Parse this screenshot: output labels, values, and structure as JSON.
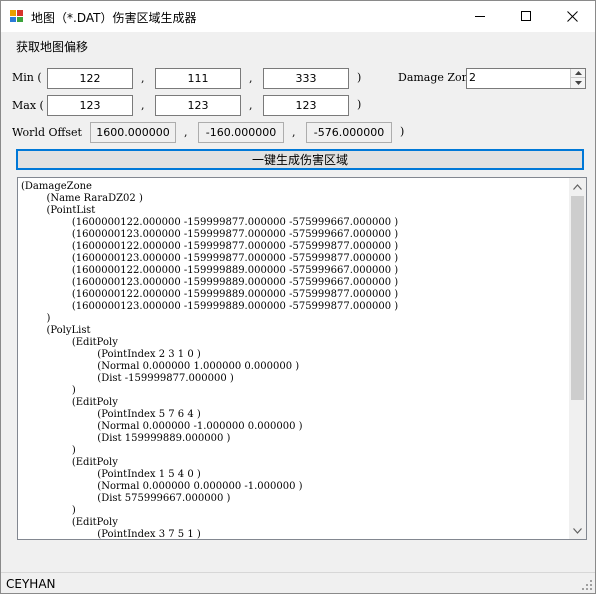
{
  "window": {
    "title": "地图（*.DAT）伤害区域生成器",
    "menu_item": "获取地图偏移"
  },
  "icons": {
    "app": "map-app-icon",
    "minimize": "minimize-icon",
    "maximize": "maximize-icon",
    "close": "close-icon",
    "spin_up": "chevron-up-icon",
    "spin_down": "chevron-down-icon",
    "scroll_up": "chevron-up-icon",
    "scroll_down": "chevron-down-icon",
    "grip": "resize-grip-icon"
  },
  "colors": {
    "accent": "#0078d7"
  },
  "form": {
    "min_label": "Min (",
    "max_label": "Max (",
    "world_offset_label": "World Offset",
    "sep_comma": ",",
    "close_paren": ")",
    "min": [
      "122",
      "111",
      "333"
    ],
    "max": [
      "123",
      "123",
      "123"
    ],
    "world_offset": [
      "1600.000000",
      "-160.000000",
      "-576.000000"
    ],
    "damage_zone_label": "Damage Zone",
    "damage_zone_value": "2"
  },
  "generate_button": "一键生成伤害区域",
  "output_text": "(DamageZone\n\t(Name RaraDZ02 )\n\t(PointList\n\t\t(1600000122.000000 -159999877.000000 -575999667.000000 )\n\t\t(1600000123.000000 -159999877.000000 -575999667.000000 )\n\t\t(1600000122.000000 -159999877.000000 -575999877.000000 )\n\t\t(1600000123.000000 -159999877.000000 -575999877.000000 )\n\t\t(1600000122.000000 -159999889.000000 -575999667.000000 )\n\t\t(1600000123.000000 -159999889.000000 -575999667.000000 )\n\t\t(1600000122.000000 -159999889.000000 -575999877.000000 )\n\t\t(1600000123.000000 -159999889.000000 -575999877.000000 )\n\t)\n\t(PolyList\n\t\t(EditPoly\n\t\t\t(PointIndex 2 3 1 0 )\n\t\t\t(Normal 0.000000 1.000000 0.000000 )\n\t\t\t(Dist -159999877.000000 )\n\t\t)\n\t\t(EditPoly\n\t\t\t(PointIndex 5 7 6 4 )\n\t\t\t(Normal 0.000000 -1.000000 0.000000 )\n\t\t\t(Dist 159999889.000000 )\n\t\t)\n\t\t(EditPoly\n\t\t\t(PointIndex 1 5 4 0 )\n\t\t\t(Normal 0.000000 0.000000 -1.000000 )\n\t\t\t(Dist 575999667.000000 )\n\t\t)\n\t\t(EditPoly\n\t\t\t(PointIndex 3 7 5 1 )",
  "status": "CEYHAN"
}
